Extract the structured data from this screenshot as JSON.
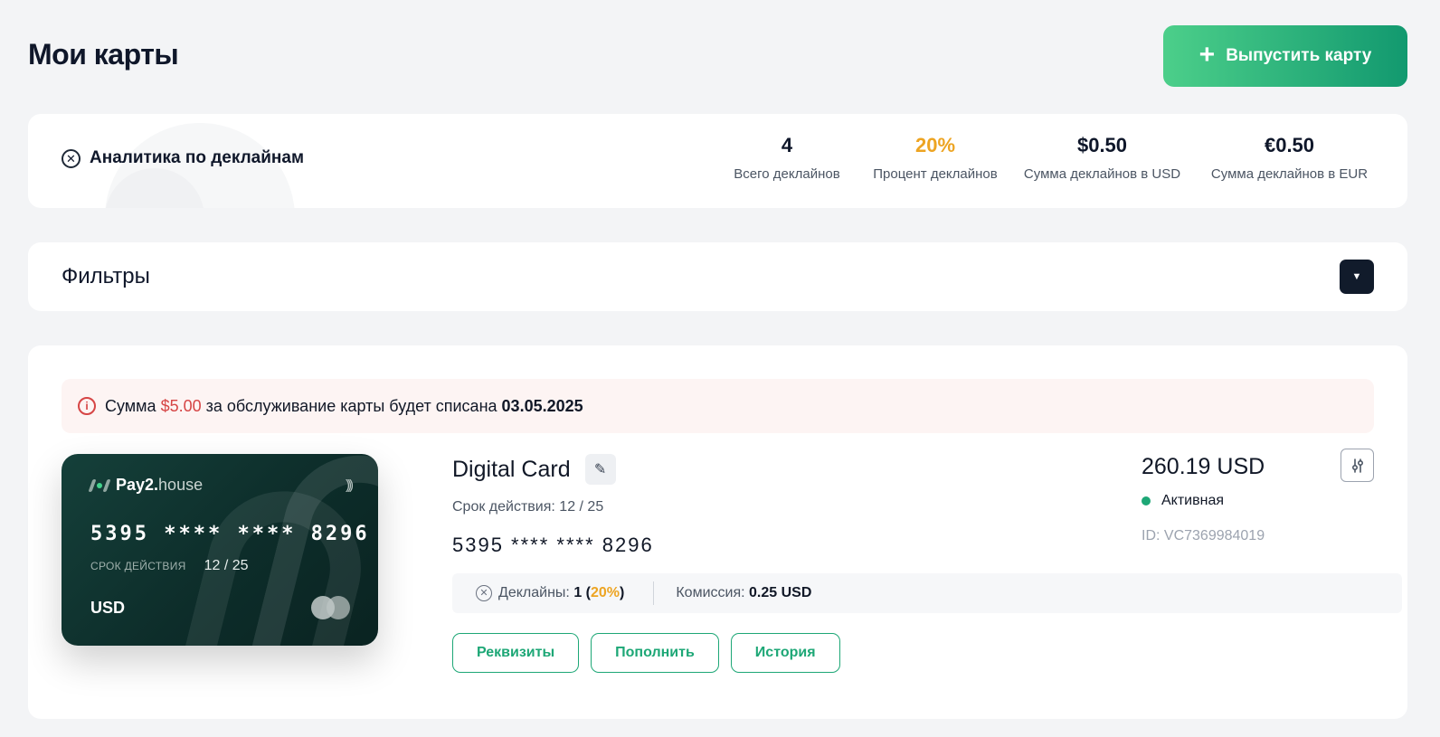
{
  "header": {
    "title": "Мои карты",
    "issue_button": "Выпустить карту",
    "issue_icon": "+"
  },
  "analytics": {
    "title": "Аналитика по деклайнам",
    "stats": [
      {
        "value": "4",
        "label": "Всего деклайнов"
      },
      {
        "value": "20%",
        "label": "Процент деклайнов"
      },
      {
        "value": "$0.50",
        "label": "Сумма деклайнов в USD"
      },
      {
        "value": "€0.50",
        "label": "Сумма деклайнов в EUR"
      }
    ]
  },
  "filters": {
    "title": "Фильтры"
  },
  "notice": {
    "prefix": "Сумма",
    "amount": "$5.00",
    "middle": "за обслуживание карты будет списана",
    "date": "03.05.2025"
  },
  "card": {
    "brand_bold": "Pay2.",
    "brand_light": "house",
    "masked_number": "5395 **** **** 8296",
    "exp_label": "СРОК ДЕЙСТВИЯ",
    "exp_value": "12 / 25",
    "currency": "USD",
    "name": "Digital Card",
    "validity": "Срок действия: 12 / 25",
    "pan": "5395 **** **** 8296",
    "declines_label": "Деклайны:",
    "declines_count": "1 (",
    "declines_percent": "20%",
    "declines_close": ")",
    "commission_label": "Комиссия:",
    "commission_value": "0.25 USD",
    "balance": "260.19 USD",
    "status": "Активная",
    "id": "ID: VC7369984019",
    "buttons": {
      "details": "Реквизиты",
      "topup": "Пополнить",
      "history": "История"
    }
  },
  "colors": {
    "accent_green": "#1da776",
    "accent_orange": "#eda422",
    "alert_red": "#d64545"
  }
}
